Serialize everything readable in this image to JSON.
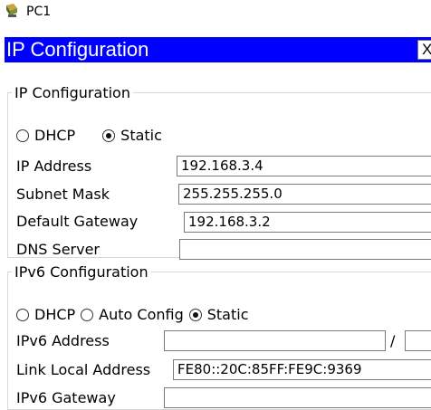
{
  "window": {
    "title": "PC1",
    "icon": "pc-icon"
  },
  "banner": {
    "title": "IP Configuration",
    "close_label": "X"
  },
  "ipv4": {
    "legend": "IP Configuration",
    "dhcp_label": "DHCP",
    "static_label": "Static",
    "selected_mode": "Static",
    "ip_address": {
      "label": "IP Address",
      "value": "192.168.3.4"
    },
    "subnet_mask": {
      "label": "Subnet Mask",
      "value": "255.255.255.0"
    },
    "default_gateway": {
      "label": "Default Gateway",
      "value": "192.168.3.2"
    },
    "dns_server": {
      "label": "DNS Server",
      "value": ""
    }
  },
  "ipv6": {
    "legend": "IPv6 Configuration",
    "dhcp_label": "DHCP",
    "auto_label": "Auto Config",
    "static_label": "Static",
    "selected_mode": "Static",
    "address": {
      "label": "IPv6 Address",
      "value": "",
      "separator": "/",
      "prefix": ""
    },
    "link_local": {
      "label": "Link Local Address",
      "value": "FE80::20C:85FF:FE9C:9369"
    },
    "gateway": {
      "label": "IPv6 Gateway",
      "value": ""
    }
  }
}
